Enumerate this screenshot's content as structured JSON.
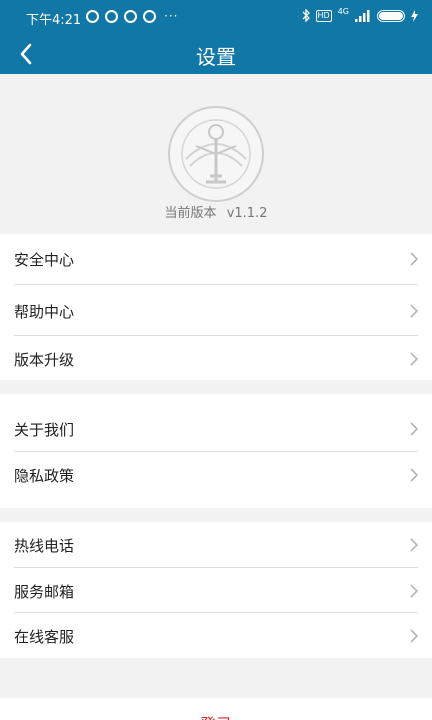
{
  "status_bar": {
    "time": "下午4:21",
    "dots": "···",
    "network": "4G",
    "hd_label": "HD",
    "battery": "100"
  },
  "nav": {
    "title": "设置",
    "back_icon": "chevron-left-icon"
  },
  "header": {
    "logo_icon": "institution-seal-icon",
    "version_label": "当前版本",
    "version_value": "v1.1.2"
  },
  "groups": [
    {
      "items": [
        {
          "label": "安全中心"
        },
        {
          "label": "帮助中心"
        },
        {
          "label": "版本升级"
        }
      ]
    },
    {
      "items": [
        {
          "label": "关于我们"
        },
        {
          "label": "隐私政策"
        }
      ]
    },
    {
      "items": [
        {
          "label": "热线电话"
        },
        {
          "label": "服务邮箱"
        },
        {
          "label": "在线客服"
        }
      ]
    }
  ],
  "logout": {
    "label": "登录"
  },
  "colors": {
    "primary": "#1177a6",
    "background": "#f2f2f2",
    "logout": "#e02020"
  }
}
